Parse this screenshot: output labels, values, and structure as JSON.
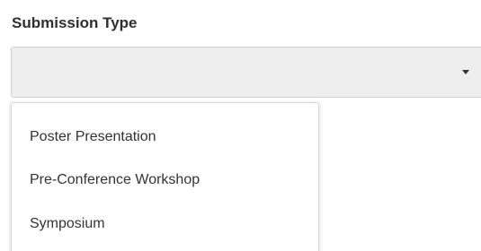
{
  "field": {
    "label": "Submission Type",
    "value": "",
    "caret_icon": "caret-down-icon"
  },
  "dropdown": {
    "options": [
      {
        "label": "Poster Presentation"
      },
      {
        "label": "Pre-Conference Workshop"
      },
      {
        "label": "Symposium"
      }
    ]
  },
  "colors": {
    "select_background": "#eeeeee",
    "text": "#333333",
    "label_text": "#2f2f2f",
    "border": "#cfcfcf"
  }
}
